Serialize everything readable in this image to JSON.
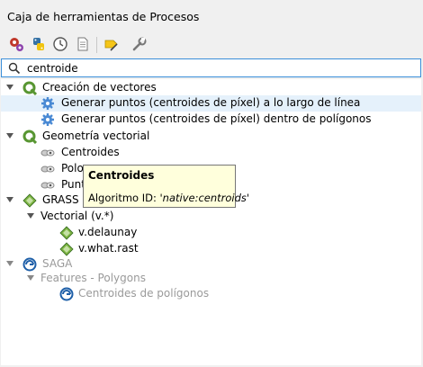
{
  "panel": {
    "title": "Caja de herramientas de Procesos"
  },
  "toolbar": {
    "buttons": [
      {
        "icon": "models-gear-icon"
      },
      {
        "icon": "python-icon"
      },
      {
        "icon": "history-clock-icon"
      },
      {
        "icon": "results-viewer-icon"
      },
      {
        "icon": "edit-features-icon"
      },
      {
        "icon": "options-wrench-icon"
      }
    ]
  },
  "search": {
    "value": "centroide",
    "icon": "search-icon"
  },
  "tree": {
    "qgis_group1": "Creación de vectores",
    "alg1": "Generar puntos (centroides de píxel) a lo largo de línea",
    "alg2": "Generar puntos (centroides de píxel) dentro de polígonos",
    "qgis_group2": "Geometría vectorial",
    "alg3": "Centroides",
    "alg4": "Polo",
    "alg5": "Punt",
    "grass": "GRASS",
    "grass_sub": "Vectorial (v.*)",
    "grass_alg1": "v.delaunay",
    "grass_alg2": "v.what.rast",
    "saga": "SAGA",
    "saga_sub": "Features - Polygons",
    "saga_alg1": "Centroides de polígonos"
  },
  "tooltip": {
    "title": "Centroides",
    "id_prefix": "Algoritmo ID: ",
    "id_value": "'native:centroids'"
  },
  "colors": {
    "accent": "#3b8fd9",
    "selection": "#e5f1fb",
    "tooltip_bg": "#ffffdc",
    "qgis_green": "#589632",
    "disabled_text": "#9a9a9a"
  }
}
